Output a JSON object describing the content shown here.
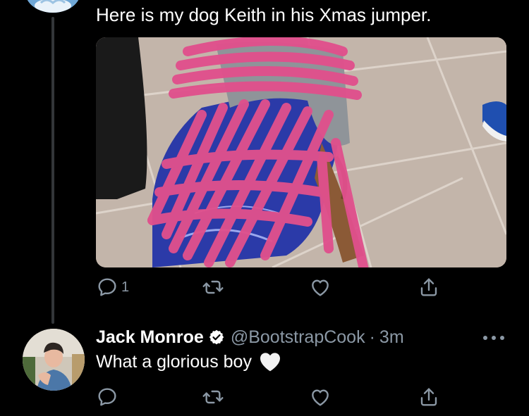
{
  "thread": {
    "tweet_text": "Here is my dog Keith in his Xmas jumper.",
    "media_alt": "Photo of a dog in a Christmas jumper, face scribbled over in pink",
    "actions": {
      "reply_count": "1",
      "retweet_count": "",
      "like_count": ""
    }
  },
  "reply": {
    "display_name": "Jack Monroe",
    "handle": "@BootstrapCook",
    "separator": "·",
    "time": "3m",
    "text": "What a glorious boy",
    "emoji": "white-heart-icon",
    "actions": {
      "reply_count": "",
      "retweet_count": "",
      "like_count": ""
    }
  },
  "colors": {
    "background": "#000000",
    "text_primary": "#ffffff",
    "text_secondary": "#8b98a5",
    "thread_line": "#333639",
    "scribble": "#e0508c",
    "verified_badge": "#ffffff"
  }
}
